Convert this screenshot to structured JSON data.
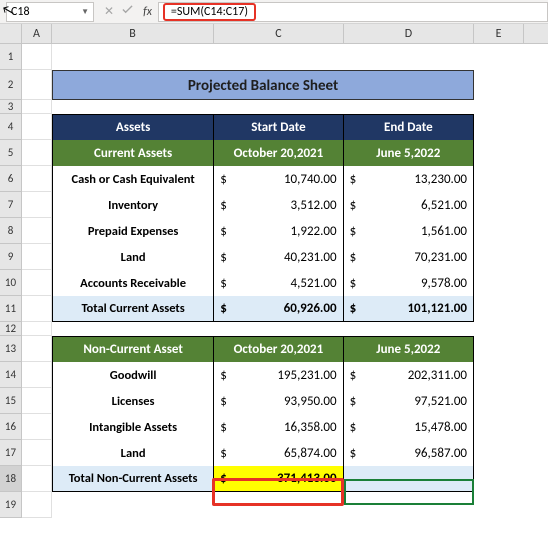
{
  "nameBox": "C18",
  "formula": "=SUM(C14:C17)",
  "columns": [
    "A",
    "B",
    "C",
    "D",
    "E"
  ],
  "rows": [
    "1",
    "2",
    "3",
    "4",
    "5",
    "6",
    "7",
    "8",
    "9",
    "10",
    "11",
    "12",
    "13",
    "14",
    "15",
    "16",
    "17",
    "18",
    "19"
  ],
  "title": "Projected Balance Sheet",
  "table1": {
    "headers": {
      "b": "Assets",
      "c": "Start Date",
      "d": "End Date"
    },
    "subheaders": {
      "b": "Current Assets",
      "c": "October 20,2021",
      "d": "June 5,2022"
    },
    "rows": [
      {
        "label": "Cash or Cash Equivalent",
        "c": "10,740.00",
        "d": "13,230.00"
      },
      {
        "label": "Inventory",
        "c": "3,512.00",
        "d": "6,521.00"
      },
      {
        "label": "Prepaid Expenses",
        "c": "1,922.00",
        "d": "1,561.00"
      },
      {
        "label": "Land",
        "c": "40,231.00",
        "d": "70,231.00"
      },
      {
        "label": "Accounts Receivable",
        "c": "4,521.00",
        "d": "9,578.00"
      }
    ],
    "total": {
      "label": "Total Current Assets",
      "c": "60,926.00",
      "d": "101,121.00"
    }
  },
  "table2": {
    "subheaders": {
      "b": "Non-Current Asset",
      "c": "October 20,2021",
      "d": "June 5,2022"
    },
    "rows": [
      {
        "label": "Goodwill",
        "c": "195,231.00",
        "d": "202,311.00"
      },
      {
        "label": "Licenses",
        "c": "93,950.00",
        "d": "97,521.00"
      },
      {
        "label": "Intangible Assets",
        "c": "16,358.00",
        "d": "15,478.00"
      },
      {
        "label": "Land",
        "c": "65,874.00",
        "d": "96,587.00"
      }
    ],
    "total": {
      "label": "Total Non-Current Assets",
      "c": "371,413.00",
      "d": ""
    }
  },
  "currency": "$"
}
